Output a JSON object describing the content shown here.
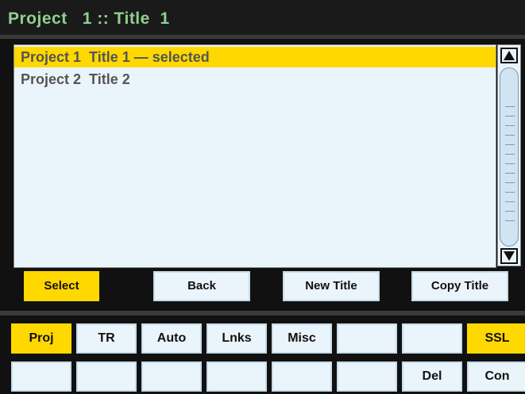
{
  "header": {
    "title": "Project   1 :: Title  1"
  },
  "list": {
    "items": [
      {
        "label": "Project 1  Title 1 — selected",
        "selected": true
      },
      {
        "label": "Project 2  Title 2",
        "selected": false
      }
    ]
  },
  "scrollbar": {
    "up_icon": "up-arrow-icon",
    "down_icon": "down-arrow-icon"
  },
  "actions": {
    "select": "Select",
    "back": "Back",
    "new_title": "New Title",
    "copy_title": "Copy Title"
  },
  "tabs_row1": [
    "Proj",
    "TR",
    "Auto",
    "Lnks",
    "Misc",
    "",
    "",
    "SSL"
  ],
  "tabs_row2": [
    "",
    "",
    "",
    "",
    "",
    "",
    "Del",
    "Con"
  ],
  "colors": {
    "accent": "#ffd800",
    "title_text": "#8fd18f",
    "panel": "#eaf4fb",
    "background": "#111111"
  }
}
